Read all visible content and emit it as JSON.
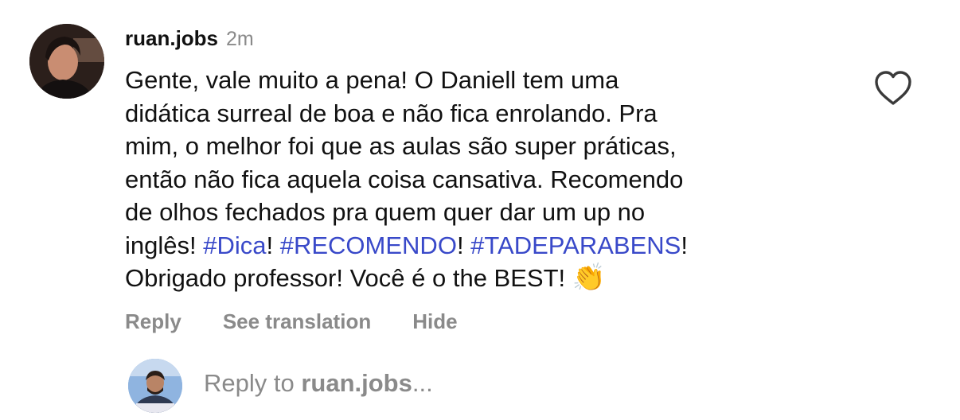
{
  "comment": {
    "username": "ruan.jobs",
    "time": "2m",
    "lines": [
      "Gente, vale muito a pena! O Daniell tem uma",
      "didática surreal de boa e não fica enrolando. Pra",
      "mim, o melhor foi que as aulas são super práticas,",
      "então não fica aquela coisa cansativa. Recomendo",
      "de olhos fechados pra quem quer dar um up no"
    ],
    "line6": {
      "prefix": "inglês! ",
      "tag1": "#Dica",
      "sep1": "! ",
      "tag2": "#RECOMENDO",
      "sep2": "! ",
      "tag3": "#TADEPARABENS",
      "suffix": "!"
    },
    "line7": {
      "text": "Obrigado professor! Você é o the BEST! ",
      "emoji": "👏"
    },
    "hashtag_color": "#3949c9",
    "like_icon": "heart-outline-icon"
  },
  "actions": {
    "reply": "Reply",
    "see_translation": "See translation",
    "hide": "Hide"
  },
  "reply_box": {
    "prefix": "Reply to ",
    "username": "ruan.jobs",
    "suffix": "..."
  }
}
